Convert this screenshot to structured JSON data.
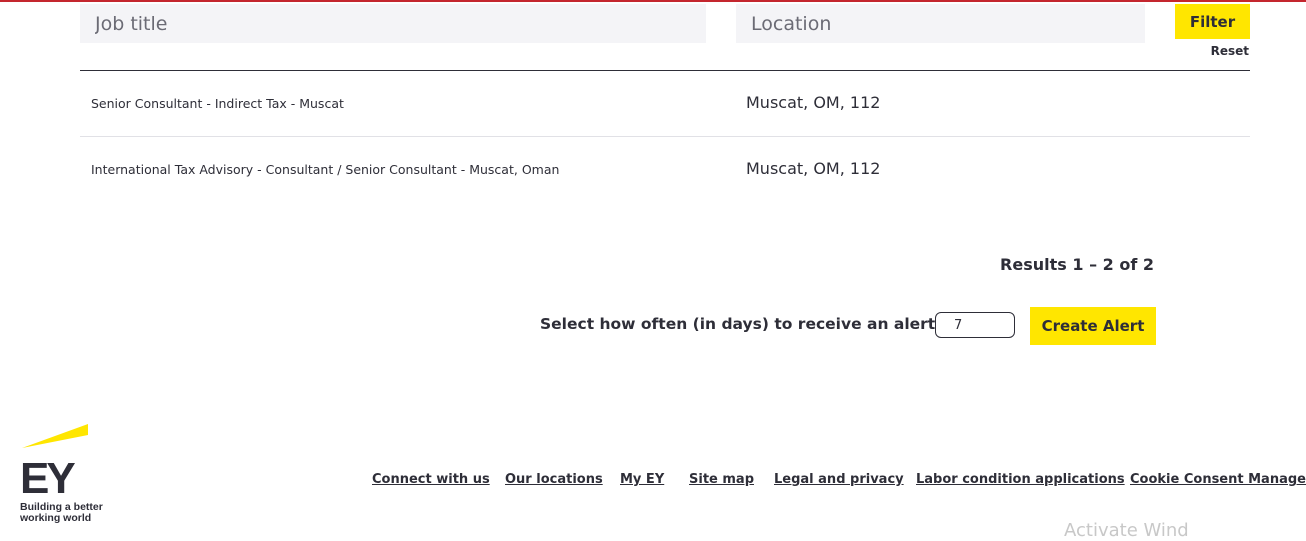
{
  "search": {
    "job_title_placeholder": "Job title",
    "location_placeholder": "Location",
    "filter_label": "Filter",
    "reset_label": "Reset"
  },
  "jobs": [
    {
      "title": "Senior Consultant - Indirect Tax - Muscat",
      "location": "Muscat, OM, 112"
    },
    {
      "title": "International Tax Advisory - Consultant / Senior Consultant - Muscat, Oman",
      "location": "Muscat, OM, 112"
    }
  ],
  "results_text": "Results 1 – 2 of 2",
  "alert": {
    "label": "Select how often (in days) to receive an alert:",
    "days_value": "7",
    "button_label": "Create Alert"
  },
  "logo": {
    "brand": "EY",
    "tagline_line1": "Building a better",
    "tagline_line2": "working world",
    "accent_color": "#ffe600"
  },
  "footer": {
    "links": [
      "Connect with us",
      "Our locations",
      "My EY",
      "Site map",
      "Legal and privacy",
      "Labor condition applications",
      "Cookie Consent Manager"
    ]
  },
  "watermark_text": "Activate Wind",
  "colors": {
    "accent_yellow": "#ffe600",
    "text_dark": "#2e2e38",
    "input_bg": "#f4f4f7",
    "top_border": "#c4262e"
  }
}
